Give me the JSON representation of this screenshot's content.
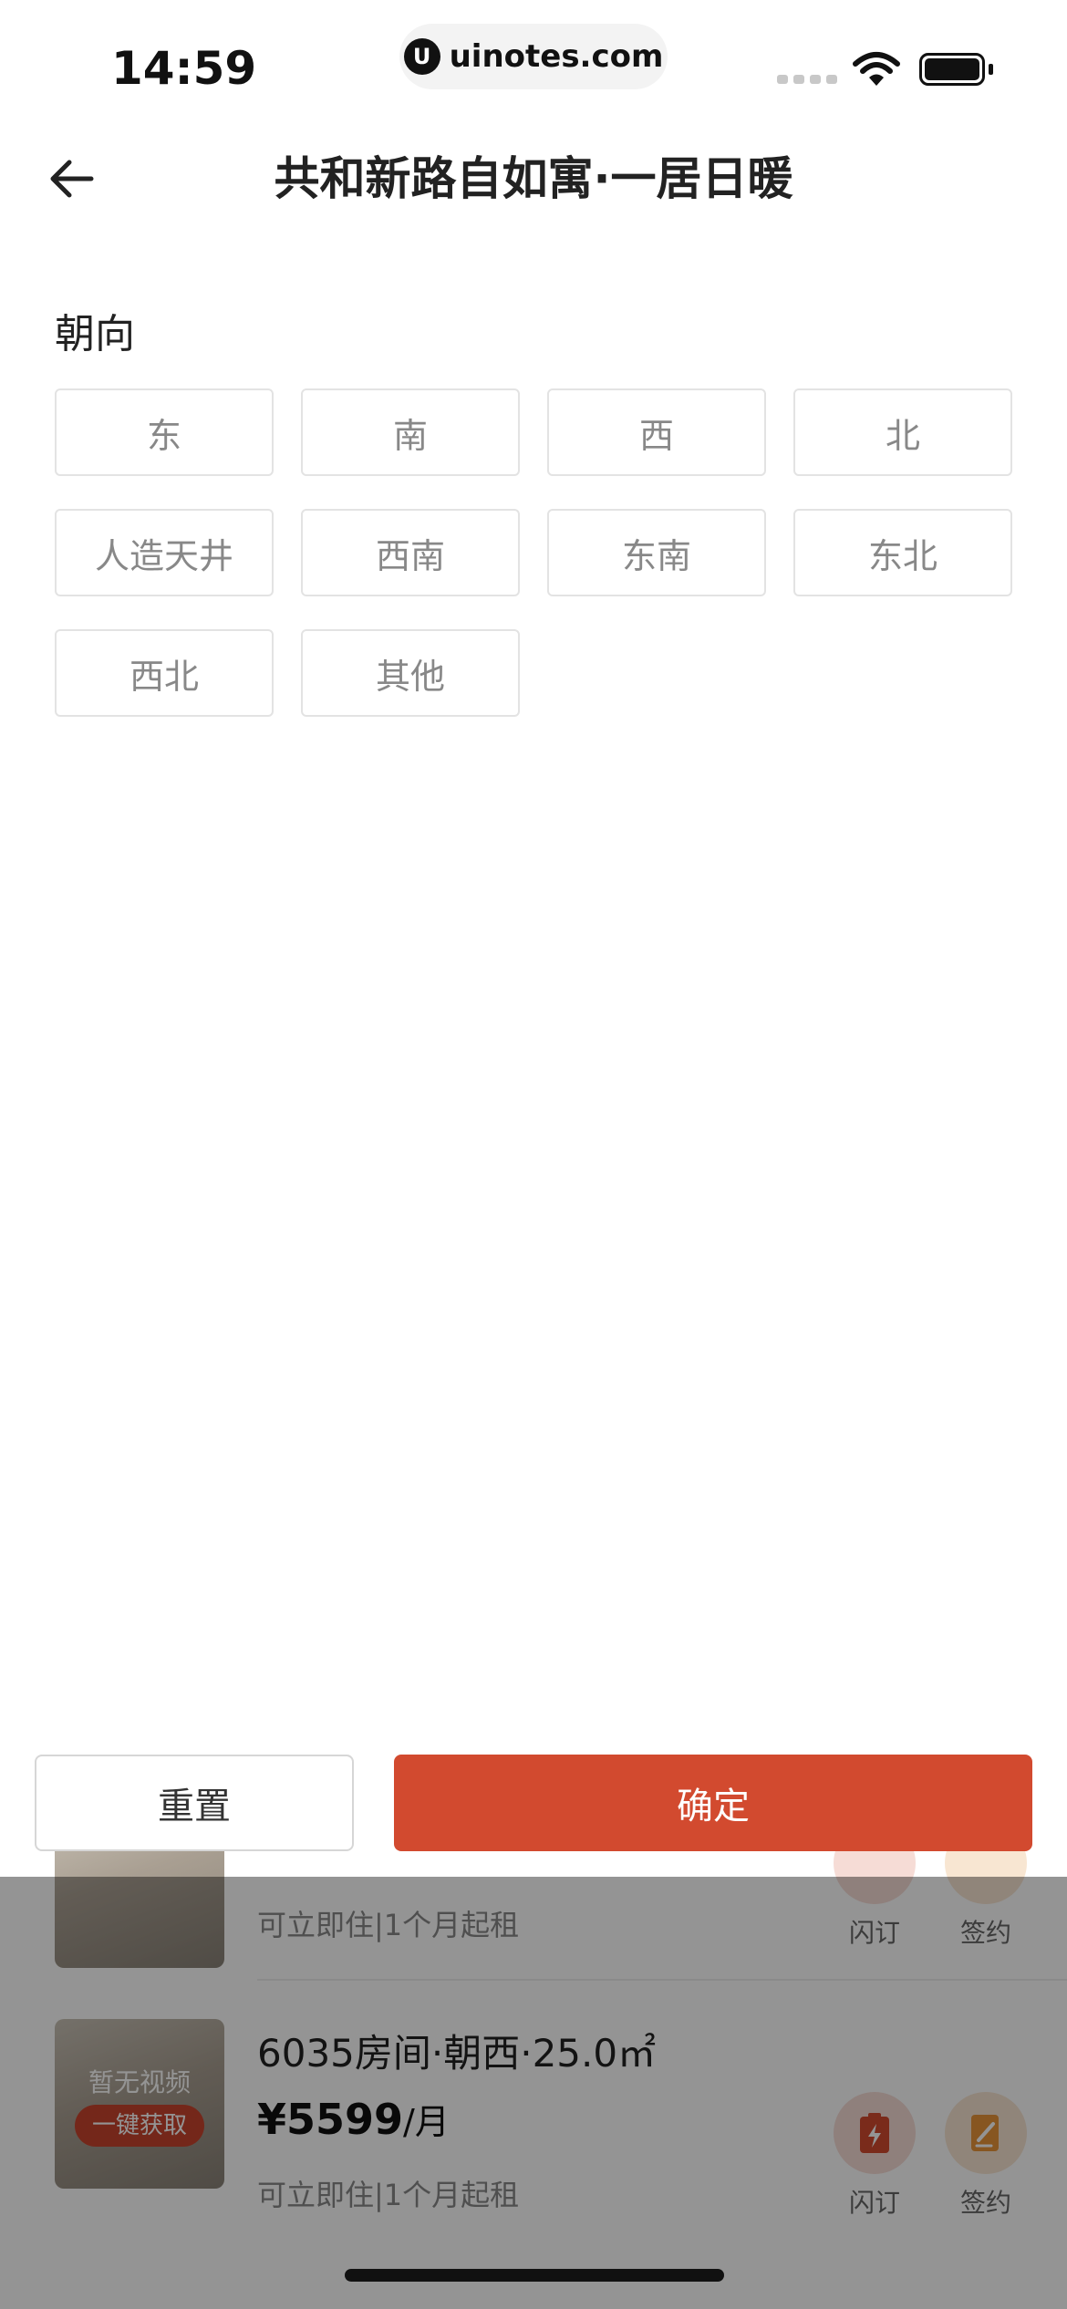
{
  "status_bar": {
    "time": "14:59",
    "url": "uinotes.com",
    "url_logo": "U"
  },
  "nav": {
    "title": "共和新路自如寓·一居日暖",
    "back_icon": "arrow-left-icon"
  },
  "filter": {
    "section_label": "朝向",
    "options": [
      "东",
      "南",
      "西",
      "北",
      "人造天井",
      "西南",
      "东南",
      "东北",
      "西北",
      "其他"
    ]
  },
  "buttons": {
    "reset": "重置",
    "confirm": "确定"
  },
  "listings": [
    {
      "availability": "可立即住|1个月起租",
      "actions": [
        {
          "label": "闪订",
          "icon": "lightning-icon"
        },
        {
          "label": "签约",
          "icon": "sign-icon"
        }
      ]
    },
    {
      "thumb_text": "暂无视频",
      "thumb_cta": "一键获取",
      "title": "6035房间·朝西·25.0㎡",
      "price": "¥5599",
      "price_unit": "/月",
      "availability": "可立即住|1个月起租",
      "actions": [
        {
          "label": "闪订",
          "icon": "lightning-icon"
        },
        {
          "label": "签约",
          "icon": "sign-icon"
        }
      ]
    }
  ],
  "colors": {
    "accent": "#d24a2f",
    "option_border": "#e3e3e3",
    "option_text": "#888888"
  }
}
